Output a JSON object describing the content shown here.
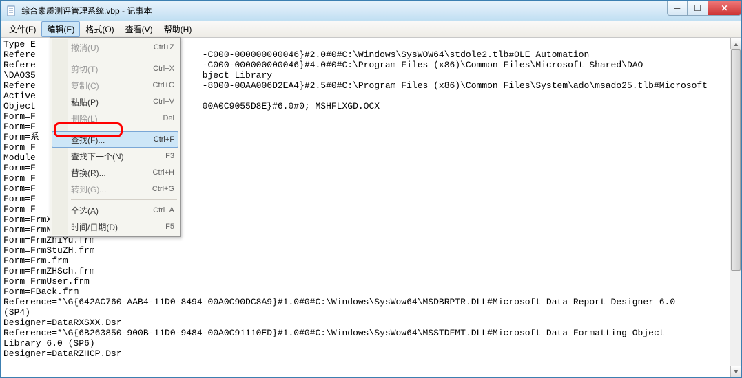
{
  "titlebar": {
    "title": "综合素质测评管理系统.vbp - 记事本"
  },
  "menubar": {
    "items": [
      {
        "label": "文件(F)"
      },
      {
        "label": "编辑(E)"
      },
      {
        "label": "格式(O)"
      },
      {
        "label": "查看(V)"
      },
      {
        "label": "帮助(H)"
      }
    ]
  },
  "dropdown": {
    "items": [
      {
        "label": "撤消(U)",
        "shortcut": "Ctrl+Z",
        "disabled": true
      },
      {
        "sep": true
      },
      {
        "label": "剪切(T)",
        "shortcut": "Ctrl+X",
        "disabled": true
      },
      {
        "label": "复制(C)",
        "shortcut": "Ctrl+C",
        "disabled": true
      },
      {
        "label": "粘贴(P)",
        "shortcut": "Ctrl+V"
      },
      {
        "label": "删除(L)",
        "shortcut": "Del",
        "disabled": true
      },
      {
        "sep": true
      },
      {
        "label": "查找(F)...",
        "shortcut": "Ctrl+F",
        "highlighted": true
      },
      {
        "label": "查找下一个(N)",
        "shortcut": "F3"
      },
      {
        "label": "替换(R)...",
        "shortcut": "Ctrl+H"
      },
      {
        "label": "转到(G)...",
        "shortcut": "Ctrl+G",
        "disabled": true
      },
      {
        "sep": true
      },
      {
        "label": "全选(A)",
        "shortcut": "Ctrl+A"
      },
      {
        "label": "时间/日期(D)",
        "shortcut": "F5"
      }
    ]
  },
  "content": {
    "text": "Type=E\nRefere                               -C000-000000000046}#2.0#0#C:\\Windows\\SysWOW64\\stdole2.tlb#OLE Automation\nRefere                               -C000-000000000046}#4.0#0#C:\\Program Files (x86)\\Common Files\\Microsoft Shared\\DAO\n\\DAO35                               bject Library\nRefere                               -8000-00AA006D2EA4}#2.5#0#C:\\Program Files (x86)\\Common Files\\System\\ado\\msado25.tlb#Microsoft\nActive\nObject                               00A0C9055D8E}#6.0#0; MSHFLXGD.OCX\nForm=F\nForm=F\nForm=系\nForm=F\nModule\nForm=F\nForm=F\nForm=F\nForm=F\nForm=F\nForm=FrmXi.frm\nForm=FrmNLLX.frm\nForm=FrmZhiYu.frm\nForm=FrmStuZH.frm\nForm=Frm.frm\nForm=FrmZHSch.frm\nForm=FrmUser.frm\nForm=FBack.frm\nReference=*\\G{642AC760-AAB4-11D0-8494-00A0C90DC8A9}#1.0#0#C:\\Windows\\SysWow64\\MSDBRPTR.DLL#Microsoft Data Report Designer 6.0\n(SP4)\nDesigner=DataRXSXX.Dsr\nReference=*\\G{6B263850-900B-11D0-9484-00A0C91110ED}#1.0#0#C:\\Windows\\SysWow64\\MSSTDFMT.DLL#Microsoft Data Formatting Object\nLibrary 6.0 (SP6)\nDesigner=DataRZHCP.Dsr"
  },
  "window_controls": {
    "min_glyph": "─",
    "max_glyph": "☐",
    "close_glyph": "✕"
  },
  "scrollbar": {
    "up_glyph": "▲",
    "down_glyph": "▼"
  }
}
